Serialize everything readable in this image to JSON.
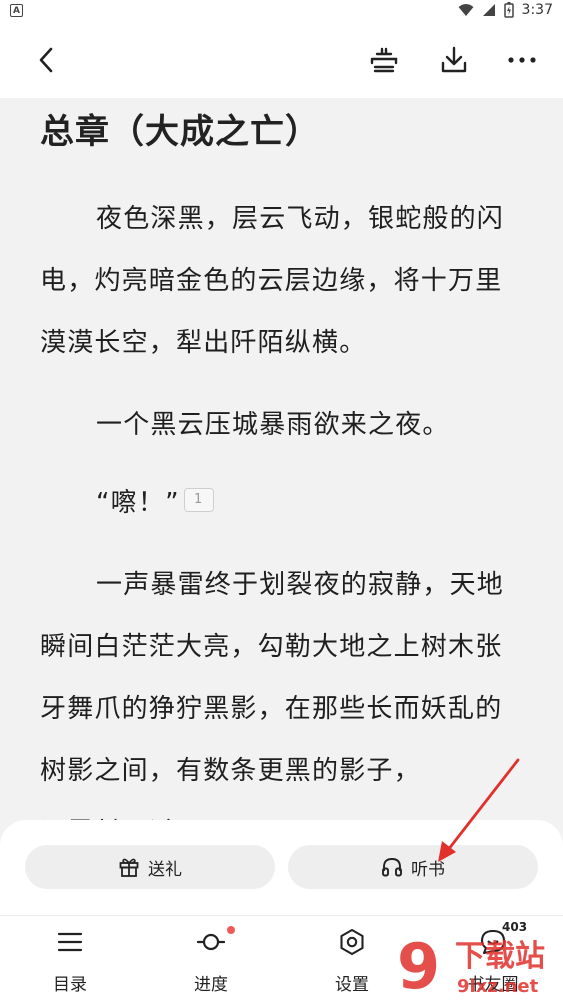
{
  "status_bar": {
    "time": "3:37",
    "left_icon_glyph": "A"
  },
  "toolbar": {
    "back_icon": "chevron-left-icon",
    "listen_mode_icon": "audio-mode-icon",
    "download_icon": "download-icon",
    "more_icon": "more-dots-icon"
  },
  "chapter": {
    "title": "总章（大成之亡）",
    "paragraphs": [
      "夜色深黑，层云飞动，银蛇般的闪电，灼亮暗金色的云层边缘，将十万里漠漠长空，犁出阡陌纵横。",
      "一个黑云压城暴雨欲来之夜。",
      "“嚓！”",
      "一声暴雷终于划裂夜的寂静，天地瞬间白茫茫大亮，勾勒大地之上树木张牙舞爪的狰狞黑影，在那些长而妖乱的树影之间，有数条更黑的影子，",
      "迅晃射而过"
    ],
    "note_count": "1"
  },
  "actions": {
    "gift_label": "送礼",
    "listen_label": "听书"
  },
  "nav": {
    "items": [
      {
        "label": "目录",
        "icon": "list-icon"
      },
      {
        "label": "进度",
        "icon": "progress-icon"
      },
      {
        "label": "设置",
        "icon": "settings-hex-icon"
      },
      {
        "label": "书友圈",
        "icon": "chat-bubble-icon"
      }
    ],
    "chat_count": "403"
  },
  "watermark": {
    "brand_top": "下载站",
    "brand_bottom": "9lxz.net",
    "glyph": "9"
  },
  "colors": {
    "accent_red": "#e0312d",
    "badge_red": "#f05a5a",
    "page_bg": "#f2f2f2"
  }
}
